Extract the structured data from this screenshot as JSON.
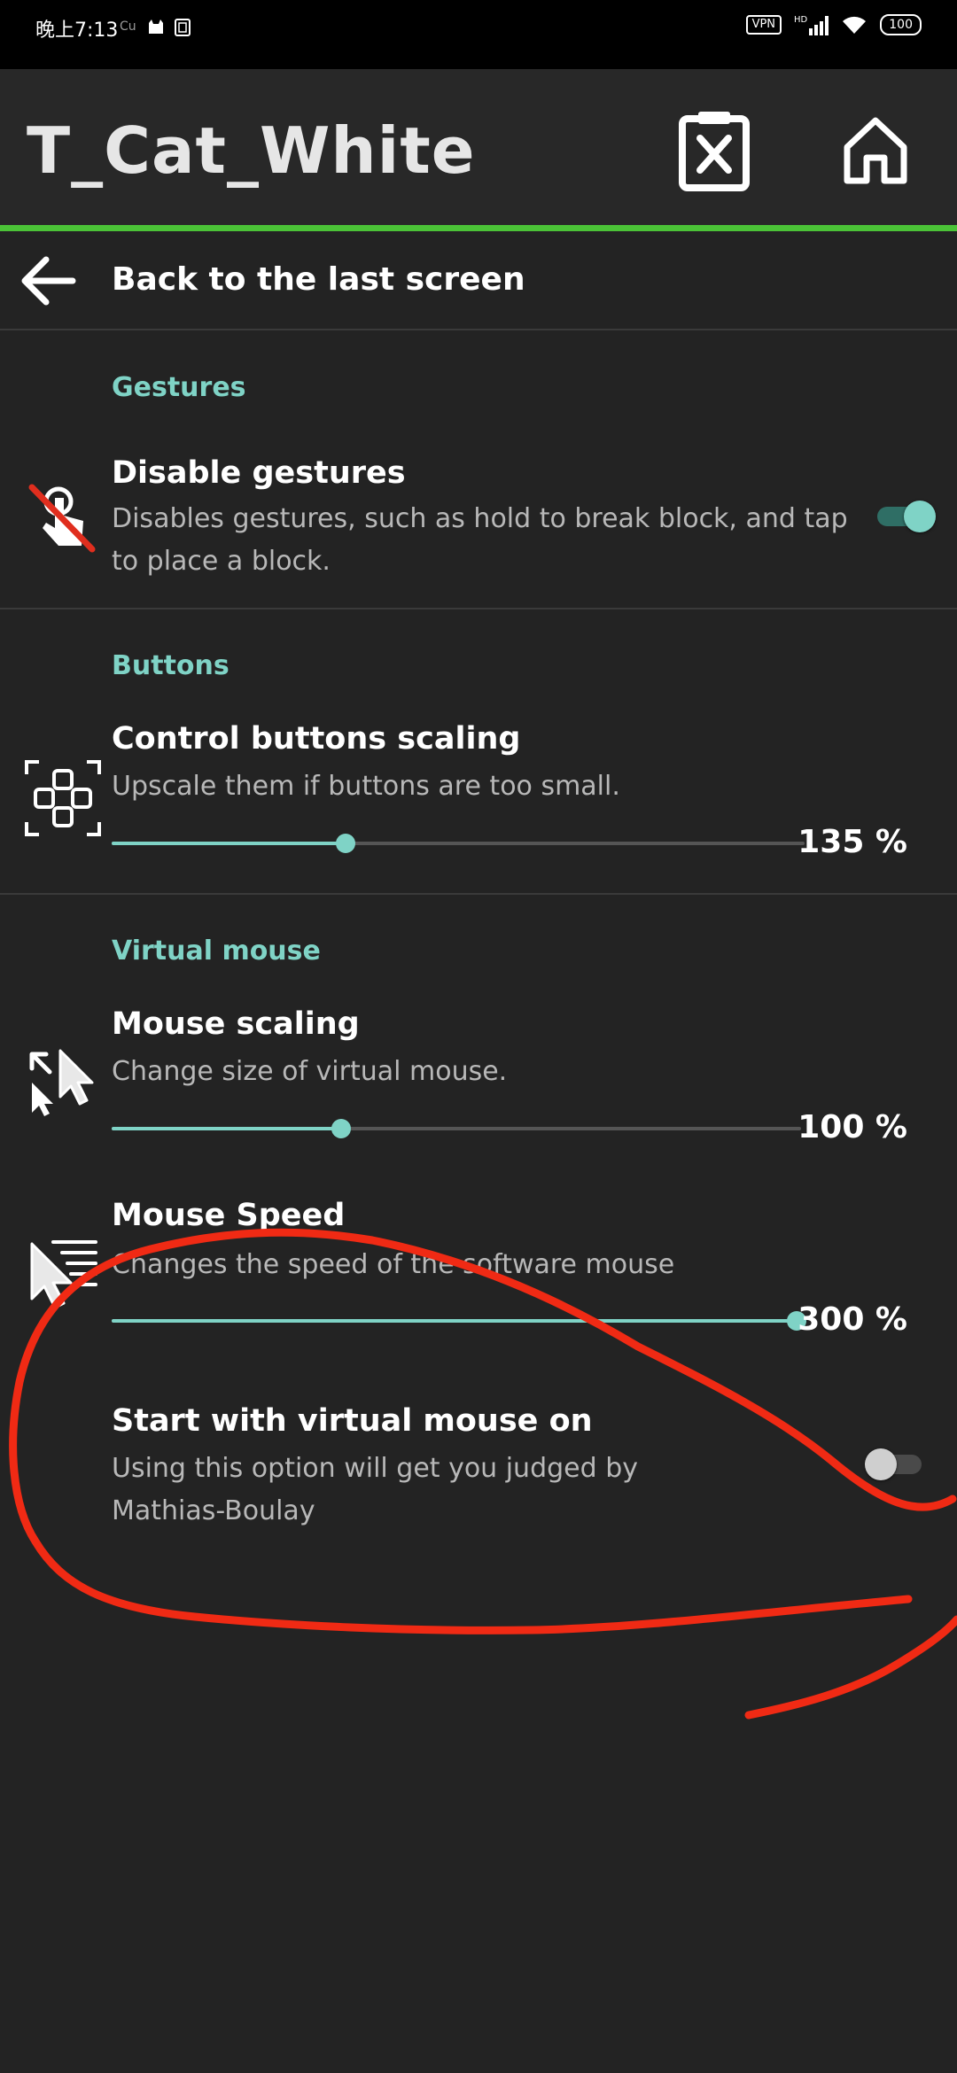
{
  "status_bar": {
    "time": "晚上7:13",
    "carrier_small": "Cu",
    "vpn": "VPN",
    "hd": "HD",
    "battery": "100"
  },
  "app_bar": {
    "title": "T_Cat_White",
    "icons": [
      "delete-clipboard-icon",
      "home-icon"
    ]
  },
  "navigation": {
    "back_label": "Back to the last screen"
  },
  "sections": {
    "gestures": {
      "header": "Gestures",
      "disable_gestures": {
        "title": "Disable gestures",
        "summary_line1": "Disables gestures, such as hold to break block, and tap",
        "summary_line2": "to place a block.",
        "enabled": true
      }
    },
    "buttons": {
      "header": "Buttons",
      "control_scaling": {
        "title": "Control buttons scaling",
        "summary": "Upscale them if buttons are too small.",
        "value": 135,
        "value_label": "135 %"
      }
    },
    "virtual_mouse": {
      "header": "Virtual mouse",
      "mouse_scaling": {
        "title": "Mouse scaling",
        "summary": "Change size of virtual mouse.",
        "value": 100,
        "value_label": "100 %"
      },
      "mouse_speed": {
        "title": "Mouse Speed",
        "summary": "Changes the speed of the software mouse",
        "value": 300,
        "value_label": "300 %"
      },
      "start_with_mouse": {
        "title": "Start with virtual mouse on",
        "summary_line1": "Using this option will get you judged by",
        "summary_line2": "Mathias-Boulay",
        "enabled": false
      }
    }
  },
  "colors": {
    "background": "#232323",
    "accent": "#7fd3c6",
    "toolbar_underline": "#4bc337",
    "annotation": "#f02a14"
  }
}
